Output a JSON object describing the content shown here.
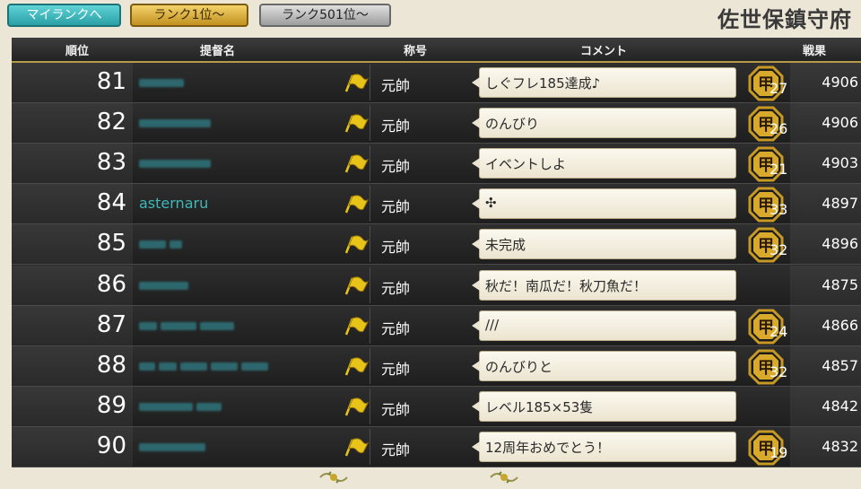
{
  "nav": {
    "my_rank": "マイランクへ",
    "rank_top": "ランク1位～",
    "rank_501": "ランク501位～"
  },
  "admiralty": "佐世保鎮守府",
  "headers": {
    "rank": "順位",
    "name": "提督名",
    "title": "称号",
    "comment": "コメント",
    "score": "戦果"
  },
  "colors": {
    "name_text": "#3fb8b8",
    "flag": "#e8c31a",
    "medal_gold": "#d9a92b"
  },
  "rows": [
    {
      "rank": "81",
      "name": "",
      "title": "元帥",
      "comment": "しぐフレ185達成♪",
      "medal": "27",
      "score": "4906"
    },
    {
      "rank": "82",
      "name": "",
      "title": "元帥",
      "comment": "のんびり",
      "medal": "26",
      "score": "4906"
    },
    {
      "rank": "83",
      "name": "",
      "title": "元帥",
      "comment": "イベントしよ",
      "medal": "21",
      "score": "4903"
    },
    {
      "rank": "84",
      "name": "asternaru",
      "title": "元帥",
      "comment": "✣",
      "medal": "33",
      "score": "4897"
    },
    {
      "rank": "85",
      "name": "",
      "title": "元帥",
      "comment": "未完成",
      "medal": "32",
      "score": "4896"
    },
    {
      "rank": "86",
      "name": "",
      "title": "元帥",
      "comment": "秋だ！南瓜だ！秋刀魚だ！",
      "medal": "",
      "score": "4875"
    },
    {
      "rank": "87",
      "name": "",
      "title": "元帥",
      "comment": "///",
      "medal": "24",
      "score": "4866"
    },
    {
      "rank": "88",
      "name": "",
      "title": "元帥",
      "comment": "のんびりと",
      "medal": "32",
      "score": "4857"
    },
    {
      "rank": "89",
      "name": "",
      "title": "元帥",
      "comment": "レベル185×53隻",
      "medal": "",
      "score": "4842"
    },
    {
      "rank": "90",
      "name": "",
      "title": "元帥",
      "comment": "12周年おめでとう！",
      "medal": "19",
      "score": "4832"
    }
  ],
  "medal_icon": "kou-medal-icon",
  "flag_icon": "flag-icon"
}
